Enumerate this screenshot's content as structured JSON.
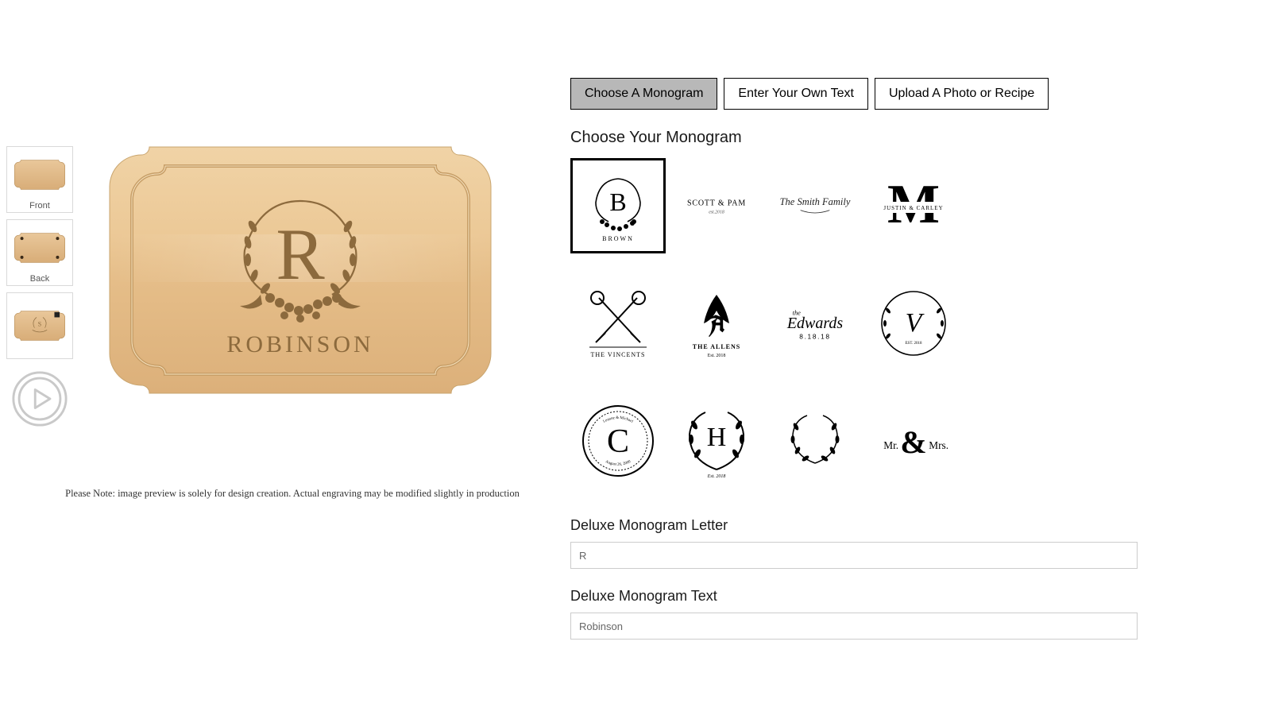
{
  "thumbnails": [
    {
      "label": "Front"
    },
    {
      "label": "Back"
    }
  ],
  "preview": {
    "monogram_letter": "R",
    "monogram_text_caps": "ROBINSON"
  },
  "disclaimer": "Please Note: image preview is solely for design creation. Actual engraving may be modified slightly in production",
  "tabs": {
    "choose": "Choose A Monogram",
    "text": "Enter Your Own Text",
    "upload": "Upload A Photo or Recipe"
  },
  "choose_heading": "Choose Your Monogram",
  "monograms": [
    {
      "id": "laurel-b",
      "sample_letter": "B",
      "sample_text": "BROWN",
      "selected": true
    },
    {
      "id": "scott-pam",
      "sample_text": "SCOTT & PAM",
      "sample_sub": "est.2018"
    },
    {
      "id": "smith-fam",
      "sample_text": "The Smith Family"
    },
    {
      "id": "split-m",
      "sample_letter": "M",
      "sample_text": "JUSTIN & CARLEY"
    },
    {
      "id": "keys",
      "sample_text": "THE VINCENTS"
    },
    {
      "id": "ornate-a",
      "sample_letter": "A",
      "sample_text": "THE ALLENS",
      "sample_sub": "Est. 2018"
    },
    {
      "id": "edwards",
      "sample_text_prefix": "the",
      "sample_text": "Edwards",
      "sample_sub": "8.18.18"
    },
    {
      "id": "laurel-v",
      "sample_letter": "V",
      "sample_sub": "EST. 2018"
    },
    {
      "id": "circle-c",
      "sample_letter": "C",
      "sample_text": "Leanne & Michael",
      "sample_sub": "August 26, 2000"
    },
    {
      "id": "laurel-h",
      "sample_letter": "H",
      "sample_sub": "Est. 2018"
    },
    {
      "id": "laurel-plain"
    },
    {
      "id": "mr-mrs",
      "sample_text": "Mr. & Mrs."
    }
  ],
  "fields": {
    "letter": {
      "label": "Deluxe Monogram Letter",
      "value": "R"
    },
    "text": {
      "label": "Deluxe Monogram Text",
      "value": "Robinson"
    }
  }
}
